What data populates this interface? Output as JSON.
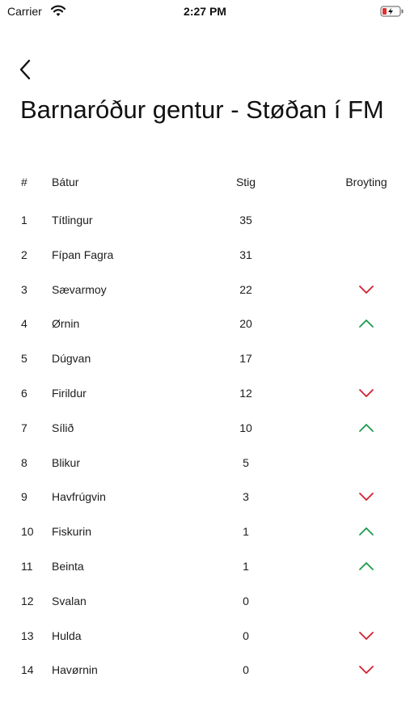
{
  "status": {
    "carrier": "Carrier",
    "time": "2:27 PM"
  },
  "page": {
    "title": "Barnaróður gentur - Støðan í FM"
  },
  "columns": {
    "rank": "#",
    "boat": "Bátur",
    "points": "Stig",
    "change": "Broyting"
  },
  "colors": {
    "up": "#1a9a4b",
    "down": "#d11f2f"
  },
  "rows": [
    {
      "rank": "1",
      "boat": "Títlingur",
      "points": "35",
      "change": "none"
    },
    {
      "rank": "2",
      "boat": "Fípan Fagra",
      "points": "31",
      "change": "none"
    },
    {
      "rank": "3",
      "boat": "Sævarmoy",
      "points": "22",
      "change": "down"
    },
    {
      "rank": "4",
      "boat": "Ørnin",
      "points": "20",
      "change": "up"
    },
    {
      "rank": "5",
      "boat": "Dúgvan",
      "points": "17",
      "change": "none"
    },
    {
      "rank": "6",
      "boat": "Firildur",
      "points": "12",
      "change": "down"
    },
    {
      "rank": "7",
      "boat": "Sílið",
      "points": "10",
      "change": "up"
    },
    {
      "rank": "8",
      "boat": "Blikur",
      "points": "5",
      "change": "none"
    },
    {
      "rank": "9",
      "boat": "Havfrúgvin",
      "points": "3",
      "change": "down"
    },
    {
      "rank": "10",
      "boat": "Fiskurin",
      "points": "1",
      "change": "up"
    },
    {
      "rank": "11",
      "boat": "Beinta",
      "points": "1",
      "change": "up"
    },
    {
      "rank": "12",
      "boat": "Svalan",
      "points": "0",
      "change": "none"
    },
    {
      "rank": "13",
      "boat": "Hulda",
      "points": "0",
      "change": "down"
    },
    {
      "rank": "14",
      "boat": "Havørnin",
      "points": "0",
      "change": "down"
    }
  ]
}
